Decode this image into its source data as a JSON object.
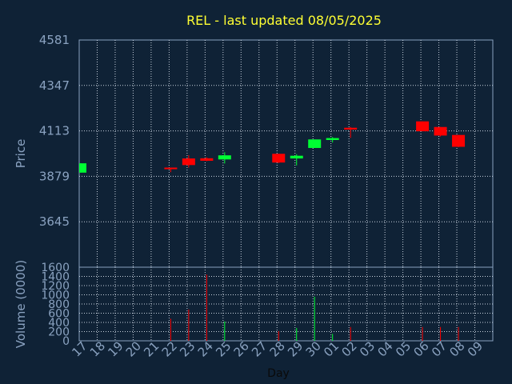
{
  "chart_data": {
    "type": "candlestick",
    "title": "REL - last updated 08/05/2025",
    "price_panel": {
      "ylabel": "Price",
      "yticks": [
        3645,
        3879,
        4113,
        4347,
        4581
      ],
      "ylim": [
        3411,
        4581
      ],
      "grid": true
    },
    "volume_panel": {
      "ylabel": "Volume (0000)",
      "yticks": [
        0,
        200,
        400,
        600,
        800,
        1000,
        1200,
        1400,
        1600
      ],
      "ylim": [
        0,
        1600
      ],
      "grid": true
    },
    "xlabel": "Day",
    "x_ticks": [
      "17",
      "18",
      "19",
      "20",
      "21",
      "22",
      "23",
      "24",
      "25",
      "26",
      "27",
      "28",
      "29",
      "30",
      "01",
      "02",
      "03",
      "04",
      "05",
      "06",
      "07",
      "08",
      "09"
    ],
    "candles": [
      {
        "day": "17",
        "open": 3898,
        "high": 3946,
        "low": 3898,
        "close": 3946,
        "volume": 0
      },
      {
        "day": "22",
        "open": 3924,
        "high": 3924,
        "low": 3900,
        "close": 3921,
        "volume": 480
      },
      {
        "day": "23",
        "open": 3971,
        "high": 3988,
        "low": 3924,
        "close": 3937,
        "volume": 680
      },
      {
        "day": "24",
        "open": 3972,
        "high": 3977,
        "low": 3957,
        "close": 3959,
        "volume": 1440
      },
      {
        "day": "25",
        "open": 3966,
        "high": 4003,
        "low": 3945,
        "close": 3987,
        "volume": 420
      },
      {
        "day": "28",
        "open": 3995,
        "high": 3995,
        "low": 3947,
        "close": 3950,
        "volume": 210
      },
      {
        "day": "29",
        "open": 3971,
        "high": 3993,
        "low": 3935,
        "close": 3985,
        "volume": 280
      },
      {
        "day": "30",
        "open": 4025,
        "high": 4069,
        "low": 4025,
        "close": 4069,
        "volume": 960
      },
      {
        "day": "01",
        "open": 4066,
        "high": 4081,
        "low": 4053,
        "close": 4076,
        "volume": 150
      },
      {
        "day": "02",
        "open": 4129,
        "high": 4133,
        "low": 4077,
        "close": 4120,
        "volume": 300
      },
      {
        "day": "06",
        "open": 4162,
        "high": 4162,
        "low": 4111,
        "close": 4111,
        "volume": 300
      },
      {
        "day": "07",
        "open": 4133,
        "high": 4133,
        "low": 4084,
        "close": 4089,
        "volume": 300
      },
      {
        "day": "08",
        "open": 4092,
        "high": 4092,
        "low": 4029,
        "close": 4031,
        "volume": 300
      }
    ],
    "colors": {
      "up": "#00ff33",
      "down": "#ff0000",
      "background": "#0f2236",
      "plot_border": "#8aa2c0",
      "grid": "#c8d2de",
      "axis_text": "#8aa2c0",
      "title": "#ffff33",
      "xlabel": "#0a0a0a"
    }
  }
}
